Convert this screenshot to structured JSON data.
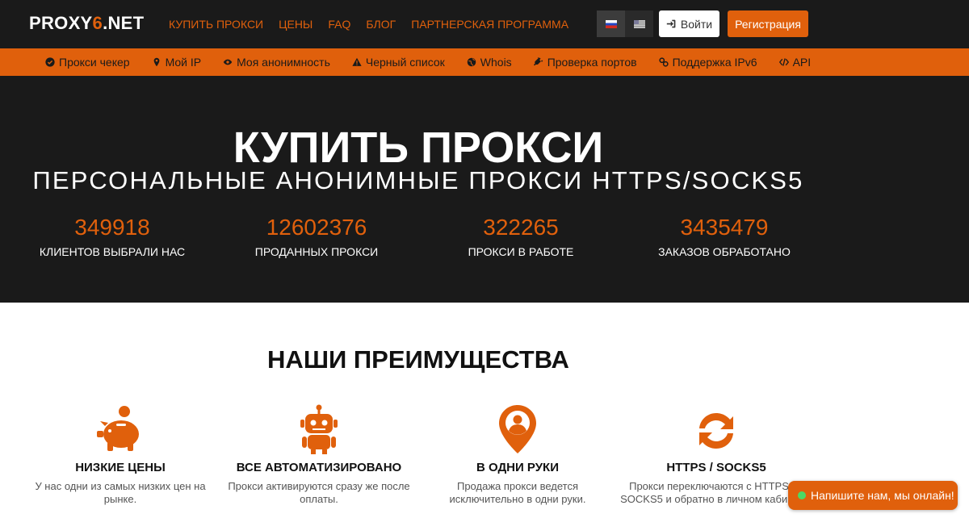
{
  "header": {
    "logo_main": "PROXY",
    "logo_accent": "6",
    "logo_tail": ".NET",
    "nav": [
      "КУПИТЬ ПРОКСИ",
      "ЦЕНЫ",
      "FAQ",
      "БЛОГ",
      "ПАРТНЕРСКАЯ ПРОГРАММА"
    ],
    "login_label": "Войти",
    "register_label": "Регистрация",
    "accent_color": "#e0600c"
  },
  "tools": [
    {
      "label": "Прокси чекер",
      "icon": "check-circle-icon"
    },
    {
      "label": "Мой IP",
      "icon": "map-marker-icon"
    },
    {
      "label": "Моя анонимность",
      "icon": "eye-icon"
    },
    {
      "label": "Черный список",
      "icon": "warning-icon"
    },
    {
      "label": "Whois",
      "icon": "globe-icon"
    },
    {
      "label": "Проверка портов",
      "icon": "plug-icon"
    },
    {
      "label": "Поддержка IPv6",
      "icon": "link-icon"
    },
    {
      "label": "API",
      "icon": "code-icon"
    }
  ],
  "hero": {
    "title": "КУПИТЬ ПРОКСИ",
    "subtitle": "ПЕРСОНАЛЬНЫЕ АНОНИМНЫЕ ПРОКСИ HTTPS/SOCKS5",
    "stats": [
      {
        "value": "349918",
        "label": "КЛИЕНТОВ ВЫБРАЛИ НАС"
      },
      {
        "value": "12602376",
        "label": "ПРОДАННЫХ ПРОКСИ"
      },
      {
        "value": "322265",
        "label": "ПРОКСИ В РАБОТЕ"
      },
      {
        "value": "3435479",
        "label": "ЗАКАЗОВ ОБРАБОТАНО"
      }
    ]
  },
  "advantages": {
    "title": "НАШИ ПРЕИМУЩЕСТВА",
    "items": [
      {
        "title": "НИЗКИЕ ЦЕНЫ",
        "text": "У нас одни из самых низких цен на рынке.",
        "icon": "piggy-bank-icon"
      },
      {
        "title": "ВСЕ АВТОМАТИЗИРОВАНО",
        "text": "Прокси активируются сразу же после оплаты.",
        "icon": "robot-icon"
      },
      {
        "title": "В ОДНИ РУКИ",
        "text": "Продажа прокси ведется исключительно в одни руки.",
        "icon": "user-pin-icon"
      },
      {
        "title": "HTTPS / SOCKS5",
        "text": "Прокси переключаются с HTTPS на SOCKS5 и обратно в личном кабинете.",
        "icon": "sync-arrows-icon"
      }
    ]
  },
  "chat": {
    "label": "Напишите нам, мы онлайн!"
  }
}
